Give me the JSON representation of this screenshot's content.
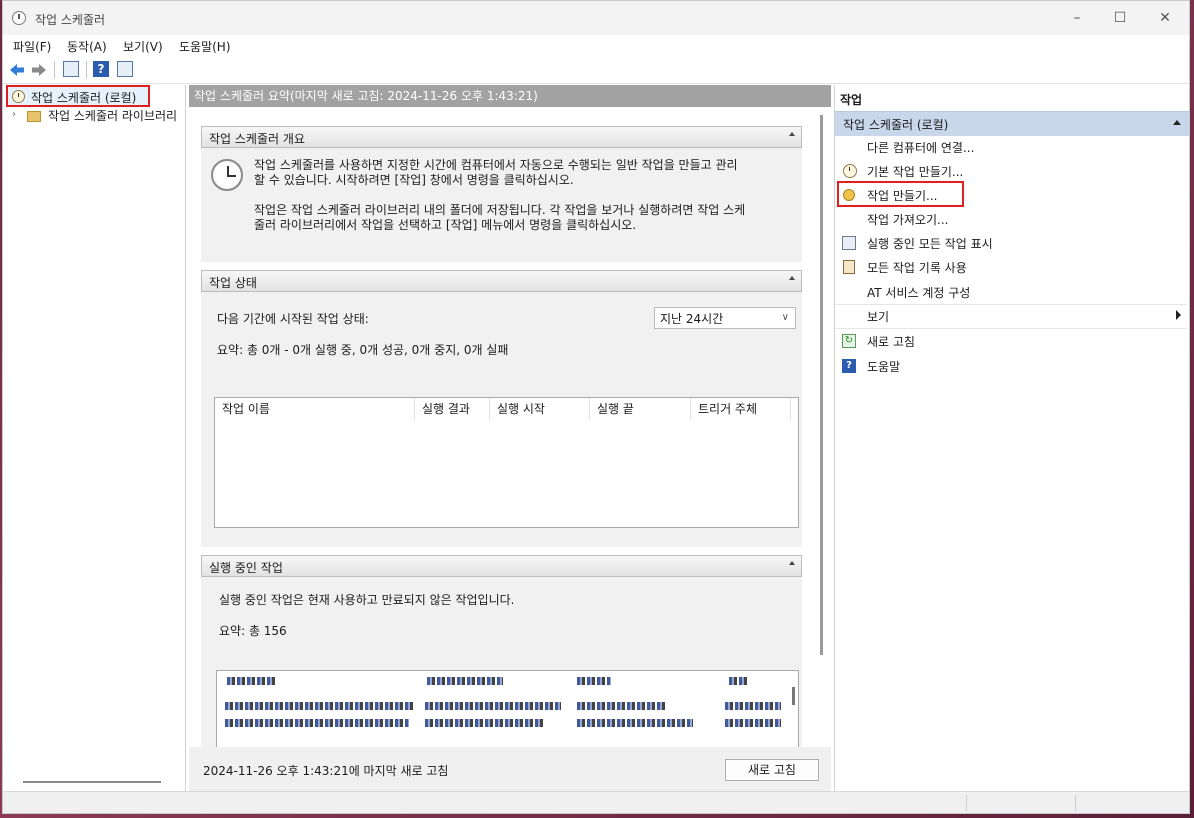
{
  "window": {
    "title": "작업 스케줄러"
  },
  "menu": [
    "파일(F)",
    "동작(A)",
    "보기(V)",
    "도움말(H)"
  ],
  "tree": {
    "root_label": "작업 스케줄러 (로컬)",
    "child_label": "작업 스케줄러 라이브러리"
  },
  "center": {
    "header": "작업 스케줄러 요약(마지막 새로 고침: 2024-11-26 오후 1:43:21)",
    "overview": {
      "title": "작업 스케줄러 개요",
      "para1_line1": "작업 스케줄러를 사용하면 지정한 시간에 컴퓨터에서 자동으로 수행되는 일반 작업을 만들고 관리",
      "para1_line2": "할 수 있습니다. 시작하려면 [작업] 창에서 명령을 클릭하십시오.",
      "para2_line1": "작업은 작업 스케줄러 라이브러리 내의 폴더에 저장됩니다. 각 작업을 보거나 실행하려면 작업 스케",
      "para2_line2": "줄러 라이브러리에서 작업을 선택하고 [작업] 메뉴에서 명령을 클릭하십시오."
    },
    "status": {
      "title": "작업 상태",
      "period_label": "다음 기간에 시작된 작업 상태:",
      "period_value": "지난 24시간",
      "summary": "요약: 총 0개 - 0개 실행 중, 0개 성공, 0개 중지, 0개 실패",
      "columns": [
        "작업 이름",
        "실행 결과",
        "실행 시작",
        "실행 끝",
        "트리거 주체"
      ]
    },
    "running": {
      "title": "실행 중인 작업",
      "desc": "실행 중인 작업은 현재 사용하고 만료되지 않은 작업입니다.",
      "summary": "요약: 총 156"
    },
    "footer": {
      "last_refresh": "2024-11-26 오후 1:43:21에 마지막 새로 고침",
      "refresh_button": "새로 고침"
    }
  },
  "actions": {
    "title": "작업",
    "group_label": "작업 스케줄러 (로컬)",
    "items": [
      {
        "label": "다른 컴퓨터에 연결...",
        "icon": "none"
      },
      {
        "label": "기본 작업 만들기...",
        "icon": "basic-task-icon"
      },
      {
        "label": "작업 만들기...",
        "icon": "create-task-icon"
      },
      {
        "label": "작업 가져오기...",
        "icon": "none"
      },
      {
        "label": "실행 중인 모든 작업 표시",
        "icon": "running-tasks-icon"
      },
      {
        "label": "모든 작업 기록 사용",
        "icon": "history-icon"
      },
      {
        "label": "AT 서비스 계정 구성",
        "icon": "none"
      },
      {
        "label": "보기",
        "icon": "none"
      },
      {
        "label": "새로 고침",
        "icon": "refresh-icon"
      },
      {
        "label": "도움말",
        "icon": "help-icon"
      }
    ]
  },
  "colors": {
    "highlight": "#e02020",
    "group_bg": "#c8d7ea",
    "accent_blue": "#2a5db0"
  }
}
